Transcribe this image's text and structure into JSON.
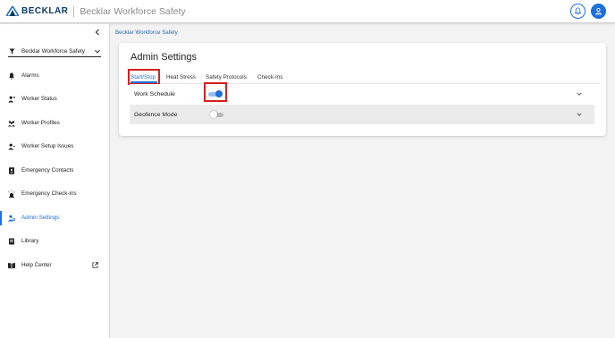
{
  "header": {
    "brand": "BECKLAR",
    "app_title": "Becklar Workforce Safety",
    "colors": {
      "primary": "#1e6fd9",
      "brand_navy": "#0b3a6b",
      "highlight": "#d42020"
    },
    "icons": {
      "bell": "bell-icon",
      "user": "user-icon"
    }
  },
  "sidebar": {
    "workspace": "Becklar Workforce Safety",
    "items": [
      {
        "label": "Alarms",
        "icon": "bell-icon"
      },
      {
        "label": "Worker Status",
        "icon": "person-icon"
      },
      {
        "label": "Worker Profiles",
        "icon": "people-icon"
      },
      {
        "label": "Worker Setup Issues",
        "icon": "person-alert-icon"
      },
      {
        "label": "Emergency Contacts",
        "icon": "contact-book-icon"
      },
      {
        "label": "Emergency Check-ins",
        "icon": "siren-icon"
      },
      {
        "label": "Admin Settings",
        "icon": "admin-icon",
        "active": true
      },
      {
        "label": "Library",
        "icon": "library-icon"
      },
      {
        "label": "Help Center",
        "icon": "book-open-icon",
        "external": true
      }
    ]
  },
  "main": {
    "breadcrumb": "Becklar Workforce Safety",
    "title": "Admin Settings",
    "tabs": [
      {
        "label": "Start/Stop",
        "active": true
      },
      {
        "label": "Heat Stress"
      },
      {
        "label": "Safety Protocols"
      },
      {
        "label": "Check-Ins"
      }
    ],
    "rows": [
      {
        "label": "Work Schedule",
        "enabled": true
      },
      {
        "label": "Geofence Mode",
        "enabled": false
      }
    ]
  }
}
